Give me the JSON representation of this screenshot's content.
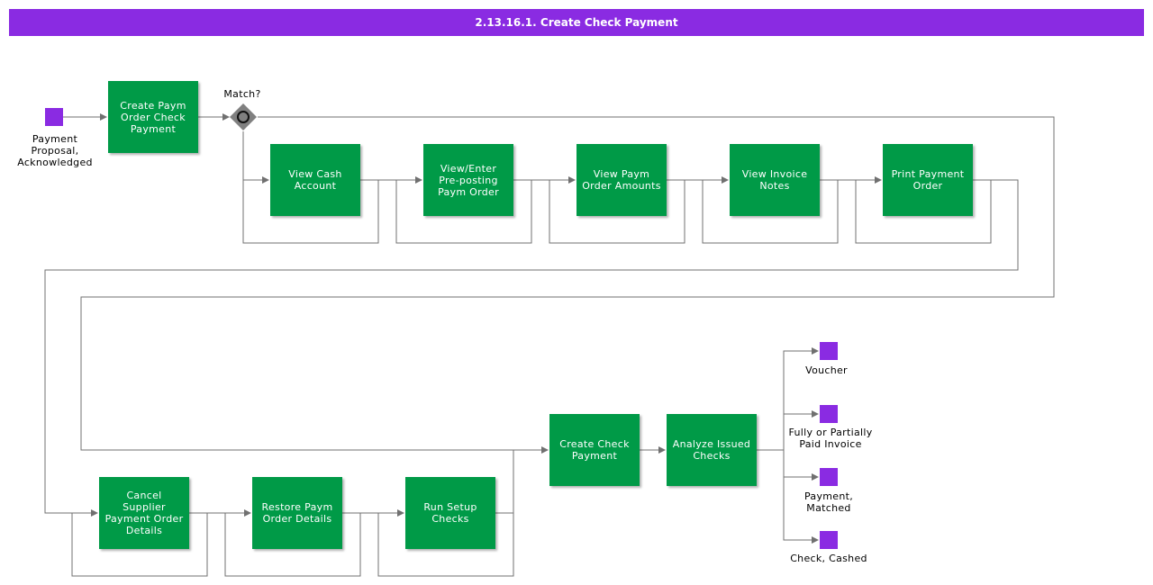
{
  "title": "2.13.16.1. Create Check Payment",
  "gateway_label": "Match?",
  "colors": {
    "title_bg": "#8a2be2",
    "activity": "#009a47",
    "event": "#8a2be2",
    "connector": "#707070",
    "gateway": "#808080"
  },
  "start_event": {
    "label": "Payment Proposal, Acknowledged"
  },
  "activities": {
    "create_paym_order": "Create Paym Order Check Payment",
    "view_cash_account": "View Cash Account",
    "view_enter_preposting": "View/Enter Pre-posting Paym Order",
    "view_paym_order_amounts": "View Paym Order Amounts",
    "view_invoice_notes": "View Invoice Notes",
    "print_payment_order": "Print Payment Order",
    "cancel_supplier": "Cancel Supplier Payment Order Details",
    "restore_paym_order": "Restore Paym Order Details",
    "run_setup_checks": "Run Setup Checks",
    "create_check_payment": "Create Check Payment",
    "analyze_issued_checks": "Analyze Issued Checks"
  },
  "end_events": {
    "voucher": "Voucher",
    "fully_paid": "Fully or Partially Paid Invoice",
    "payment_matched": "Payment, Matched",
    "check_cashed": "Check, Cashed"
  }
}
